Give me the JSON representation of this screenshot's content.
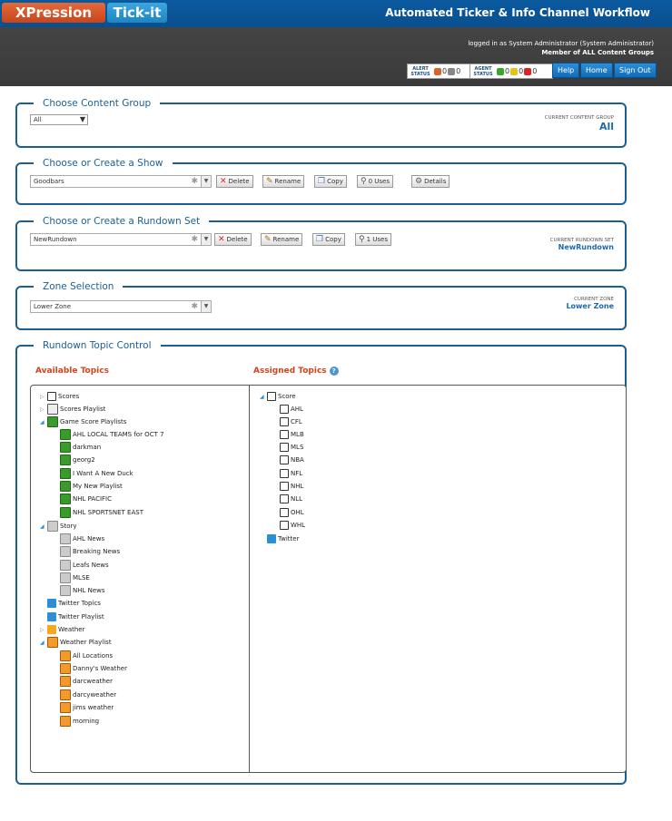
{
  "header": {
    "logo_left": "XPression",
    "logo_right": "Tick-it",
    "app_title": "Automated Ticker & Info Channel Workflow",
    "login_line": "logged in as System Administrator (System Administrator)",
    "member_line": "Member of ALL Content Groups",
    "alert_status": {
      "label": "ALERT STATUS",
      "count_a": "0",
      "count_b": "0"
    },
    "agent_status": {
      "label": "AGENT STATUS",
      "green": "0",
      "yellow": "0",
      "red": "0"
    },
    "nav": {
      "help": "Help",
      "home": "Home",
      "signout": "Sign Out"
    }
  },
  "content_group": {
    "legend": "Choose Content Group",
    "selected": "All",
    "current_label": "CURRENT CONTENT GROUP",
    "current_value": "All"
  },
  "show": {
    "legend": "Choose or Create a Show",
    "value": "Goodbars",
    "buttons": {
      "delete": "Delete",
      "rename": "Rename",
      "copy": "Copy",
      "uses": "0 Uses",
      "details": "Details"
    }
  },
  "rundown": {
    "legend": "Choose or Create a Rundown Set",
    "value": "NewRundown",
    "buttons": {
      "delete": "Delete",
      "rename": "Rename",
      "copy": "Copy",
      "uses": "1 Uses"
    },
    "current_label": "CURRENT RUNDOWN SET",
    "current_value": "NewRundown"
  },
  "zone": {
    "legend": "Zone Selection",
    "value": "Lower Zone",
    "current_label": "CURRENT ZONE",
    "current_value": "Lower Zone"
  },
  "topics": {
    "legend": "Rundown Topic Control",
    "available_title": "Available Topics",
    "assigned_title": "Assigned Topics",
    "available": {
      "scores": "Scores",
      "scores_playlist": "Scores Playlist",
      "game_score_playlists": "Game Score Playlists",
      "gsp_items": [
        "AHL LOCAL TEAMS for OCT 7",
        "darkman",
        "georg2",
        "I Want A New Duck",
        "My New Playlist",
        "NHL PACIFIC",
        "NHL SPORTSNET EAST"
      ],
      "story": "Story",
      "story_items": [
        "AHL News",
        "Breaking News",
        "Leafs News",
        "MLSE",
        "NHL News"
      ],
      "twitter_topics": "Twitter Topics",
      "twitter_playlist": "Twitter Playlist",
      "weather": "Weather",
      "weather_playlist": "Weather Playlist",
      "wp_items": [
        "All Locations",
        "Danny's Weather",
        "darcweather",
        "darcyweather",
        "jims weather",
        "morning"
      ]
    },
    "assigned": {
      "score": "Score",
      "score_items": [
        "AHL",
        "CFL",
        "MLB",
        "MLS",
        "NBA",
        "NFL",
        "NHL",
        "NLL",
        "OHL",
        "WHL"
      ],
      "twitter": "Twitter"
    }
  }
}
